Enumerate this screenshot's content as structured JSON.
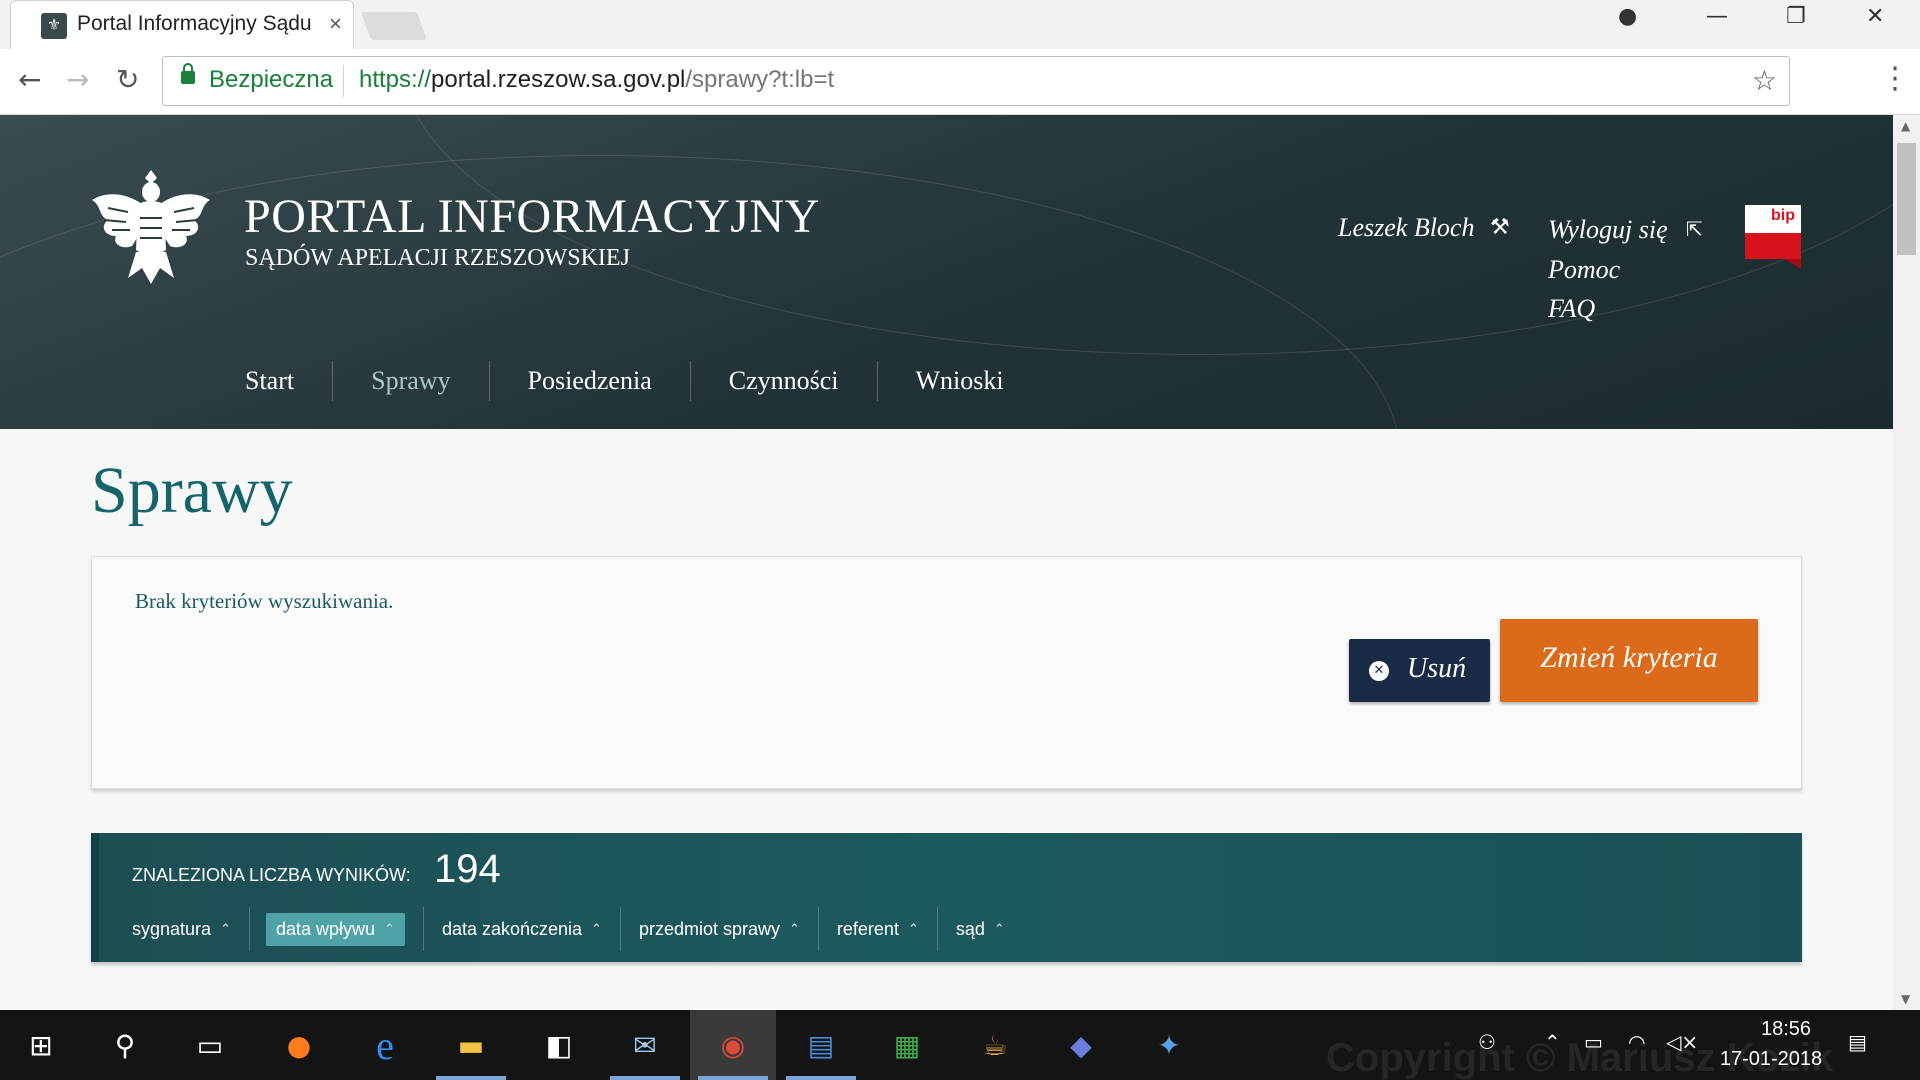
{
  "browser": {
    "tab_title": "Portal Informacyjny Sądu",
    "tab_close": "×",
    "secure_label": "Bezpieczna",
    "url_protocol": "https://",
    "url_host": "portal.rzeszow.sa.gov.pl",
    "url_path": "/sprawy?t:lb=t"
  },
  "header": {
    "title": "PORTAL INFORMACYJNY",
    "subtitle": "SĄDÓW APELACJI RZESZOWSKIEJ",
    "user_name": "Leszek Bloch",
    "logout": "Wyloguj się",
    "help": "Pomoc",
    "faq": "FAQ",
    "bip": "bip"
  },
  "nav": [
    "Start",
    "Sprawy",
    "Posiedzenia",
    "Czynności",
    "Wnioski"
  ],
  "nav_active": "Sprawy",
  "page": {
    "title": "Sprawy",
    "criteria_text": "Brak kryteriów wyszukiwania.",
    "delete_button": "Usuń",
    "change_button": "Zmień kryteria"
  },
  "results": {
    "label": "ZNALEZIONA LICZBA WYNIKÓW:",
    "count": "194",
    "sort_columns": [
      "sygnatura",
      "data wpływu",
      "data zakończenia",
      "przedmiot sprawy",
      "referent",
      "sąd"
    ],
    "active_sort": "data wpływu"
  },
  "taskbar": {
    "time": "18:56",
    "date": "17-01-2018",
    "watermark": "Copyright © Mariusz Kozik"
  },
  "colors": {
    "header_bg": "#213336",
    "title_teal": "#15646a",
    "results_bg": "#1c5a5f",
    "delete_btn": "#1a2b46",
    "change_btn": "#db6a1a"
  }
}
